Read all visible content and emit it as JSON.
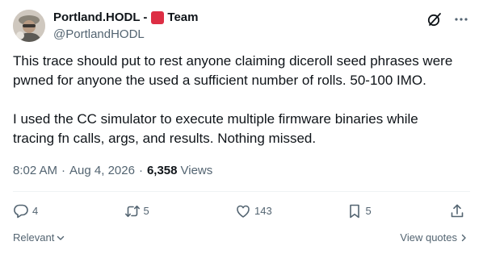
{
  "author": {
    "display_name": "Portland.HODL -",
    "display_name_suffix": "Team",
    "handle": "@PortlandHODL"
  },
  "tweet": {
    "paragraph1_line1": "This trace should put to rest anyone claiming diceroll seed phrases were",
    "paragraph1_line2": "pwned for anyone the used a sufficient number of rolls. 50-100 IMO.",
    "paragraph2_line1": "I used the CC simulator to execute multiple firmware binaries while",
    "paragraph2_line2": "tracing fn calls, args, and results. Nothing missed."
  },
  "meta": {
    "time": "8:02 AM",
    "separator": "·",
    "date": "Aug 4, 2026",
    "views_count": "6,358",
    "views_label": "Views"
  },
  "actions": {
    "reply_count": "4",
    "repost_count": "5",
    "like_count": "143",
    "bookmark_count": "5"
  },
  "footer": {
    "sort_label": "Relevant",
    "view_quotes_label": "View quotes"
  },
  "icons": {
    "grok": "grok-icon",
    "more": "more-icon",
    "reply": "reply-icon",
    "repost": "repost-icon",
    "like": "heart-icon",
    "bookmark": "bookmark-icon",
    "share": "share-icon"
  },
  "colors": {
    "text_primary": "#0f1419",
    "text_secondary": "#536471",
    "flag_red": "#dd2e44",
    "divider": "#eff3f4"
  }
}
